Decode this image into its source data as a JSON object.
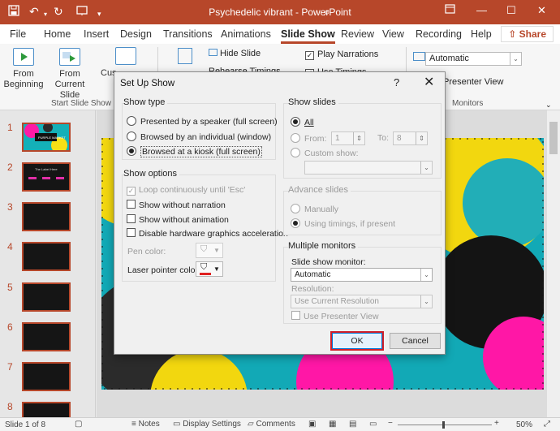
{
  "app": {
    "title": "Psychedelic vibrant  -  PowerPoint",
    "accent": "#b7472a"
  },
  "quick_access": [
    "save-icon",
    "undo-icon",
    "undo-dropdown-icon",
    "redo-icon",
    "present-icon",
    "more-icon"
  ],
  "tabs": [
    "File",
    "Home",
    "Insert",
    "Design",
    "Transitions",
    "Animations",
    "Slide Show",
    "Review",
    "View",
    "Recording",
    "Help"
  ],
  "active_tab": "Slide Show",
  "share_label": "Share",
  "ribbon": {
    "from_beginning": "From Beginning",
    "from_current": "From Current Slide",
    "custom_partial": "Cus",
    "custom_partial2": "S",
    "hide_slide": "Hide Slide",
    "rehearse": "Rehearse Timings",
    "play_narrations": "Play Narrations",
    "use_timings": "Use Timings",
    "monitor_value": "Automatic",
    "presenter_view": "Presenter View",
    "group_start": "Start Slide Show",
    "group_monitors": "Monitors"
  },
  "slides": {
    "numbers": [
      "1",
      "2",
      "3",
      "4",
      "5",
      "6",
      "7",
      "8"
    ],
    "thumb1_text": "PURPLE MARKET",
    "thumb2_text": "The Label Here"
  },
  "status": {
    "slide_info": "Slide 1 of 8",
    "notes": "Notes",
    "display": "Display Settings",
    "comments": "Comments",
    "zoom": "50%",
    "minus": "−",
    "plus": "+"
  },
  "dialog": {
    "title": "Set Up Show",
    "help": "?",
    "close": "✕",
    "show_type": {
      "label": "Show type",
      "options": [
        "Presented by a speaker (full screen)",
        "Browsed by an individual (window)",
        "Browsed at a kiosk (full screen)"
      ],
      "selected": 2
    },
    "show_options": {
      "label": "Show options",
      "loop": "Loop continuously until 'Esc'",
      "no_narration": "Show without narration",
      "no_animation": "Show without animation",
      "no_hw": "Disable hardware graphics acceleration",
      "pen_color": "Pen color:",
      "laser_color": "Laser pointer color:"
    },
    "show_slides": {
      "label": "Show slides",
      "all": "All",
      "from": "From:",
      "from_val": "1",
      "to": "To:",
      "to_val": "8",
      "custom": "Custom show:"
    },
    "advance": {
      "label": "Advance slides",
      "manually": "Manually",
      "timings": "Using timings, if present"
    },
    "monitors": {
      "label": "Multiple monitors",
      "monitor_label": "Slide show monitor:",
      "monitor_value": "Automatic",
      "resolution_label": "Resolution:",
      "resolution_value": "Use Current Resolution",
      "presenter": "Use Presenter View"
    },
    "ok": "OK",
    "cancel": "Cancel"
  },
  "colors": {
    "laser": "#e02020",
    "slide_bg": "#0ea5b5",
    "kiosk_highlight": "#d0202a"
  }
}
